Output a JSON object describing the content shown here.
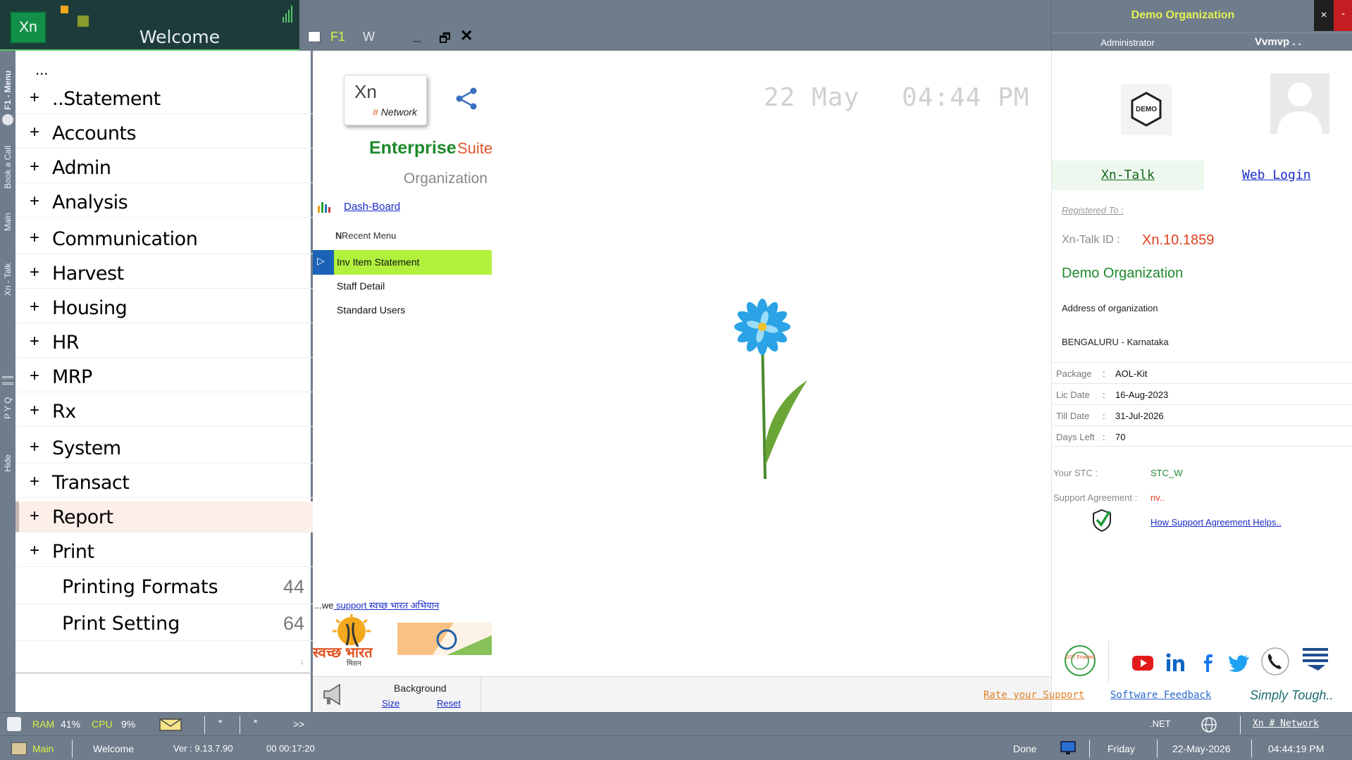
{
  "app": {
    "logo": "Xn",
    "welcome_title": "Welcome",
    "tabs": {
      "f1": "F1",
      "w": "W",
      "minimize": "_",
      "restore": "🗗",
      "close": "✕"
    }
  },
  "org_header": {
    "name": "Demo Organization",
    "close_x": "×",
    "close_red": "-",
    "role": "Administrator",
    "user": "Vvmvp . ."
  },
  "vstrip": {
    "items": [
      "F1 - Menu",
      "Book a Call",
      "Main",
      "Xn - Talk",
      "P Y Q",
      "Hide"
    ]
  },
  "menu": {
    "ellipsis": "...",
    "items": [
      {
        "plus": "+",
        "label": "..Statement"
      },
      {
        "plus": "+",
        "label": "Accounts"
      },
      {
        "plus": "+",
        "label": "Admin"
      },
      {
        "plus": "+",
        "label": "Analysis"
      },
      {
        "plus": "+",
        "label": "Communication"
      },
      {
        "plus": "+",
        "label": "Harvest"
      },
      {
        "plus": "+",
        "label": "Housing"
      },
      {
        "plus": "+",
        "label": "HR"
      },
      {
        "plus": "+",
        "label": "MRP"
      },
      {
        "plus": "+",
        "label": "Rx"
      },
      {
        "plus": "+",
        "label": "System"
      },
      {
        "plus": "+",
        "label": "Transact"
      },
      {
        "plus": "+",
        "label": "Report"
      },
      {
        "plus": "+",
        "label": "Print"
      }
    ],
    "sub_items": [
      {
        "label": "Printing Formats",
        "count": "44"
      },
      {
        "label": "Print Setting",
        "count": "64"
      }
    ],
    "scroll_arrow": "↓"
  },
  "center": {
    "card_xn": "Xn",
    "card_hash": "#",
    "card_network": "Network",
    "enterprise": "Enterprise",
    "suite": "Suite",
    "organization": "Organization",
    "dashboard_link": "Dash-Board",
    "recent_menu_label": "Recent Menu",
    "recent_marker": "N",
    "recent_items": [
      "Inv Item Statement",
      "Staff Detail",
      "Standard Users"
    ],
    "swachh_prefix": "...we",
    "swachh_link": " support स्वच्छ भारत अभियान",
    "swachh_logo_text": "स्वच्छ भारत",
    "swachh_logo_sub": "मिशन"
  },
  "main": {
    "date": "22 May",
    "time": "04:44 PM"
  },
  "bottom_tools": {
    "background_label": "Background",
    "size_link": "Size",
    "reset_link": "Reset",
    "rate_support": "Rate your Support",
    "software_feedback": "Software Feedback",
    "simply_tough": "Simply Tough.."
  },
  "info": {
    "demo_badge": "DEMO",
    "xn_talk": "Xn-Talk",
    "web_login": "Web Login",
    "registered_to": "Registered To :",
    "talk_id_label": "Xn-Talk ID :",
    "talk_id_value": "Xn.10.1859",
    "org_name": "Demo Organization",
    "address": "Address of organization",
    "city": "BENGALURU - Karnataka",
    "license": [
      {
        "key": "Package",
        "colon": ":",
        "value": "AOL-Kit"
      },
      {
        "key": "Lic Date",
        "colon": ":",
        "value": "16-Aug-2023"
      },
      {
        "key": "Till Date",
        "colon": ":",
        "value": "31-Jul-2026"
      },
      {
        "key": "Days Left",
        "colon": ":",
        "value": "70"
      }
    ],
    "stc_label": "Your STC :",
    "stc_value": "STC_W",
    "support_agreement_label": "Support Agreement :",
    "support_agreement_value": "nv..",
    "support_help_link": "How Support Agreement Helps..",
    "gst_badge": "GST Enabled",
    "colors": {
      "accent_green": "#1d8a2a",
      "accent_orange": "#e0552c",
      "link_blue": "#1a2cc9",
      "status_yellow": "#d6f23f"
    }
  },
  "status1": {
    "ram_label": "RAM",
    "ram_value": "41%",
    "cpu_label": "CPU",
    "cpu_value": "9%",
    "star1": "*",
    "star2": "*",
    "more": ">>",
    "dotnet": ".NET",
    "xn_network": "Xn # Network"
  },
  "status2": {
    "main": "Main",
    "welcome": "Welcome",
    "version": "Ver : 9.13.7.90",
    "elapsed": "00 00:17:20",
    "done": "Done",
    "day": "Friday",
    "date": "22-May-2026",
    "time": "04:44:19 PM"
  }
}
